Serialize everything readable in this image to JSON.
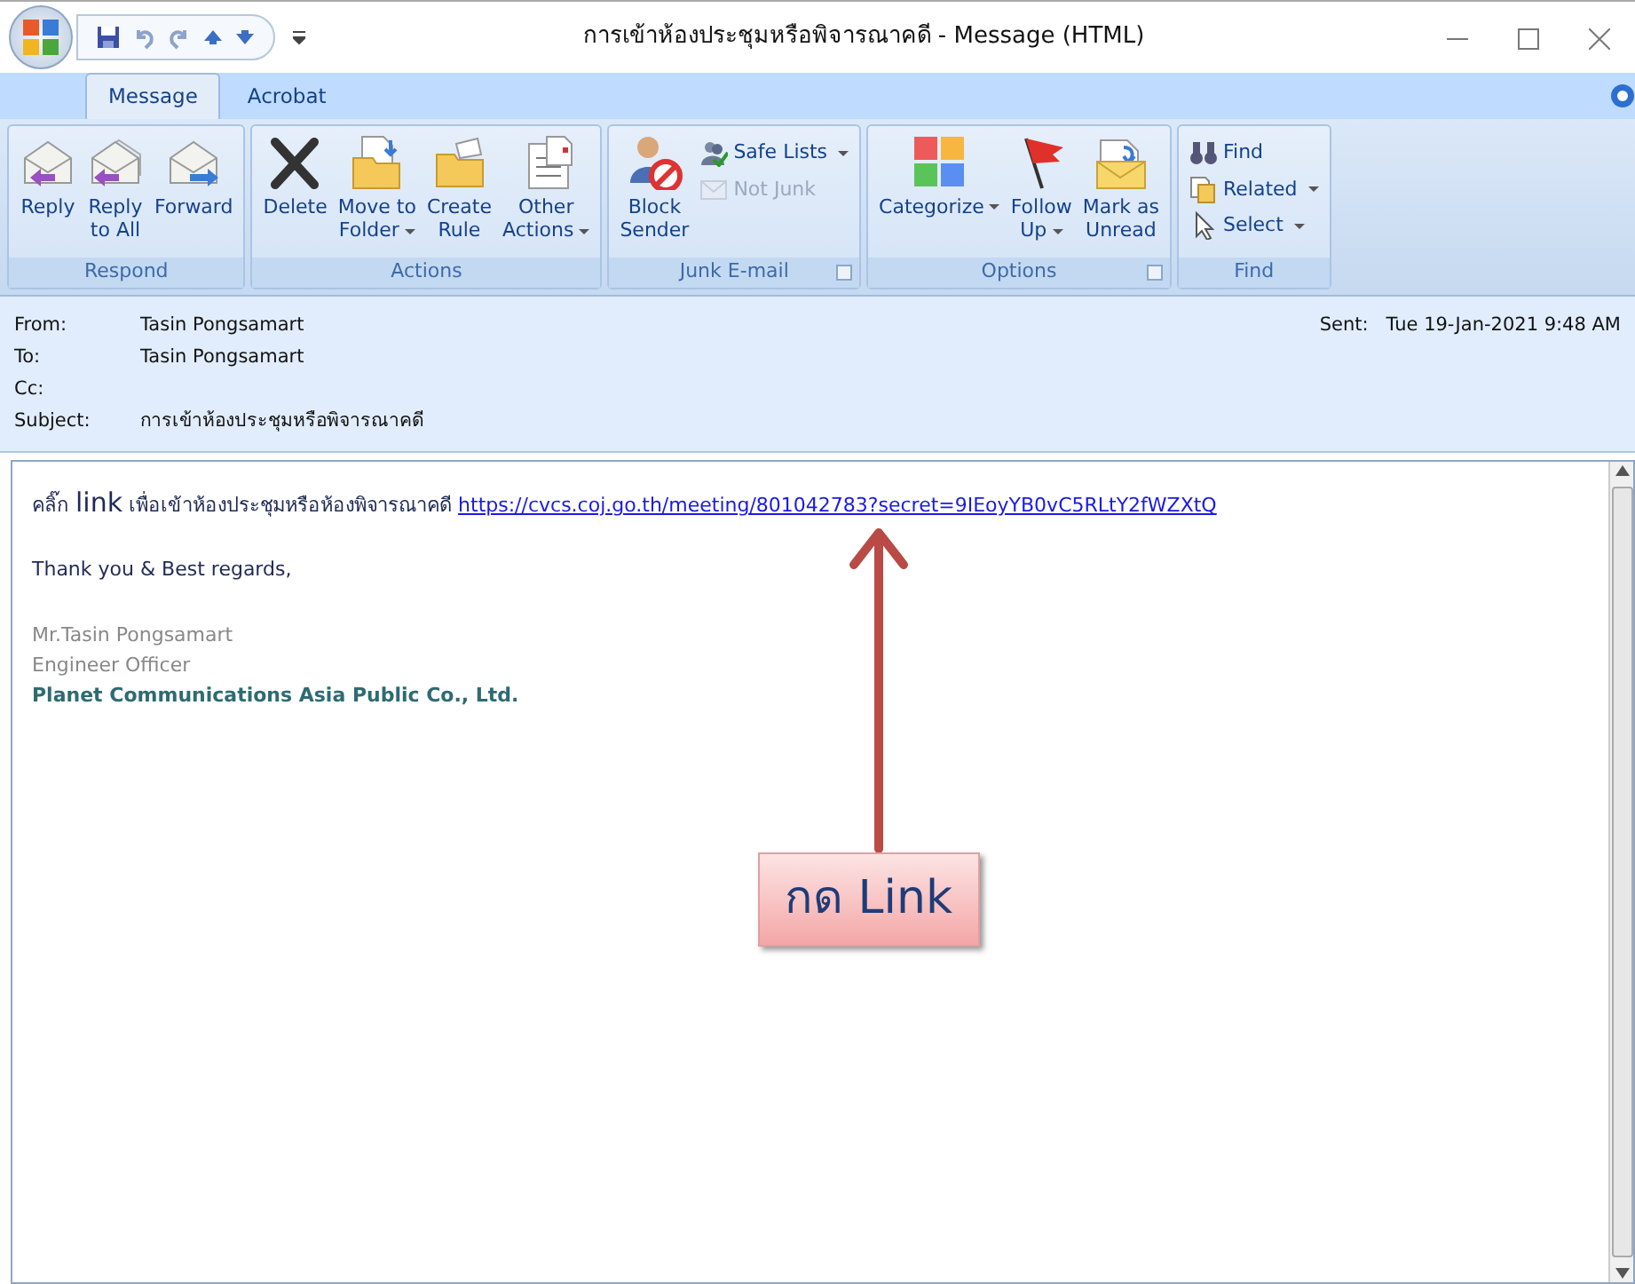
{
  "window": {
    "title": "การเข้าห้องประชุมหรือพิจารณาคดี - Message (HTML)"
  },
  "tabs": [
    {
      "label": "Message",
      "selected": true
    },
    {
      "label": "Acrobat",
      "selected": false
    }
  ],
  "ribbon": [
    {
      "name": "Respond",
      "launcher": false,
      "buttons": [
        {
          "kind": "large",
          "label": "Reply",
          "dropdown": false,
          "disabled": false
        },
        {
          "kind": "large",
          "label": "Reply\nto All",
          "dropdown": false,
          "disabled": false
        },
        {
          "kind": "large",
          "label": "Forward",
          "dropdown": false,
          "disabled": false
        }
      ]
    },
    {
      "name": "Actions",
      "launcher": false,
      "buttons": [
        {
          "kind": "large",
          "label": "Delete",
          "dropdown": false,
          "disabled": false
        },
        {
          "kind": "large",
          "label": "Move to\nFolder",
          "dropdown": true,
          "disabled": false
        },
        {
          "kind": "large",
          "label": "Create\nRule",
          "dropdown": false,
          "disabled": false
        },
        {
          "kind": "large",
          "label": "Other\nActions",
          "dropdown": true,
          "disabled": false
        }
      ]
    },
    {
      "name": "Junk E-mail",
      "launcher": true,
      "buttons": [
        {
          "kind": "large",
          "label": "Block\nSender",
          "dropdown": false,
          "disabled": false
        },
        {
          "kind": "small",
          "label": "Safe Lists",
          "dropdown": true,
          "disabled": false
        },
        {
          "kind": "small",
          "label": "Not Junk",
          "dropdown": false,
          "disabled": true
        }
      ]
    },
    {
      "name": "Options",
      "launcher": true,
      "buttons": [
        {
          "kind": "large",
          "label": "Categorize",
          "dropdown": true,
          "disabled": false
        },
        {
          "kind": "large",
          "label": "Follow\nUp",
          "dropdown": true,
          "disabled": false
        },
        {
          "kind": "large",
          "label": "Mark as\nUnread",
          "dropdown": false,
          "disabled": false
        }
      ]
    },
    {
      "name": "Find",
      "launcher": false,
      "buttons": [
        {
          "kind": "small",
          "label": "Find",
          "dropdown": false,
          "disabled": false
        },
        {
          "kind": "small",
          "label": "Related",
          "dropdown": true,
          "disabled": false
        },
        {
          "kind": "small",
          "label": "Select",
          "dropdown": true,
          "disabled": false
        }
      ]
    }
  ],
  "header": {
    "fields": [
      {
        "label": "From:",
        "value": "Tasin Pongsamart"
      },
      {
        "label": "To:",
        "value": "Tasin Pongsamart"
      },
      {
        "label": "Cc:"
      },
      {
        "label": "Subject:",
        "value": "การเข้าห้องประชุมหรือพิจารณาคดี"
      }
    ],
    "sent_label": "Sent:",
    "sent_value": "Tue 19-Jan-2021 9:48 AM"
  },
  "body": {
    "intro_before": "คลิ๊ก",
    "intro_emphasis": "link",
    "intro_after": "เพื่อเข้าห้องประชุมหรือห้องพิจารณาคดี",
    "link": "https://cvcs.coj.go.th/meeting/801042783?secret=9IEoyYB0vC5RLtY2fWZXtQ",
    "closing": "Thank you & Best regards,",
    "signature": [
      {
        "kind": "plain",
        "text": "Mr.Tasin Pongsamart"
      },
      {
        "kind": "plain",
        "text": "Engineer Officer"
      },
      {
        "kind": "company",
        "text": "Planet Communications Asia Public Co., Ltd."
      }
    ]
  },
  "annotation": {
    "text": "กด Link"
  }
}
